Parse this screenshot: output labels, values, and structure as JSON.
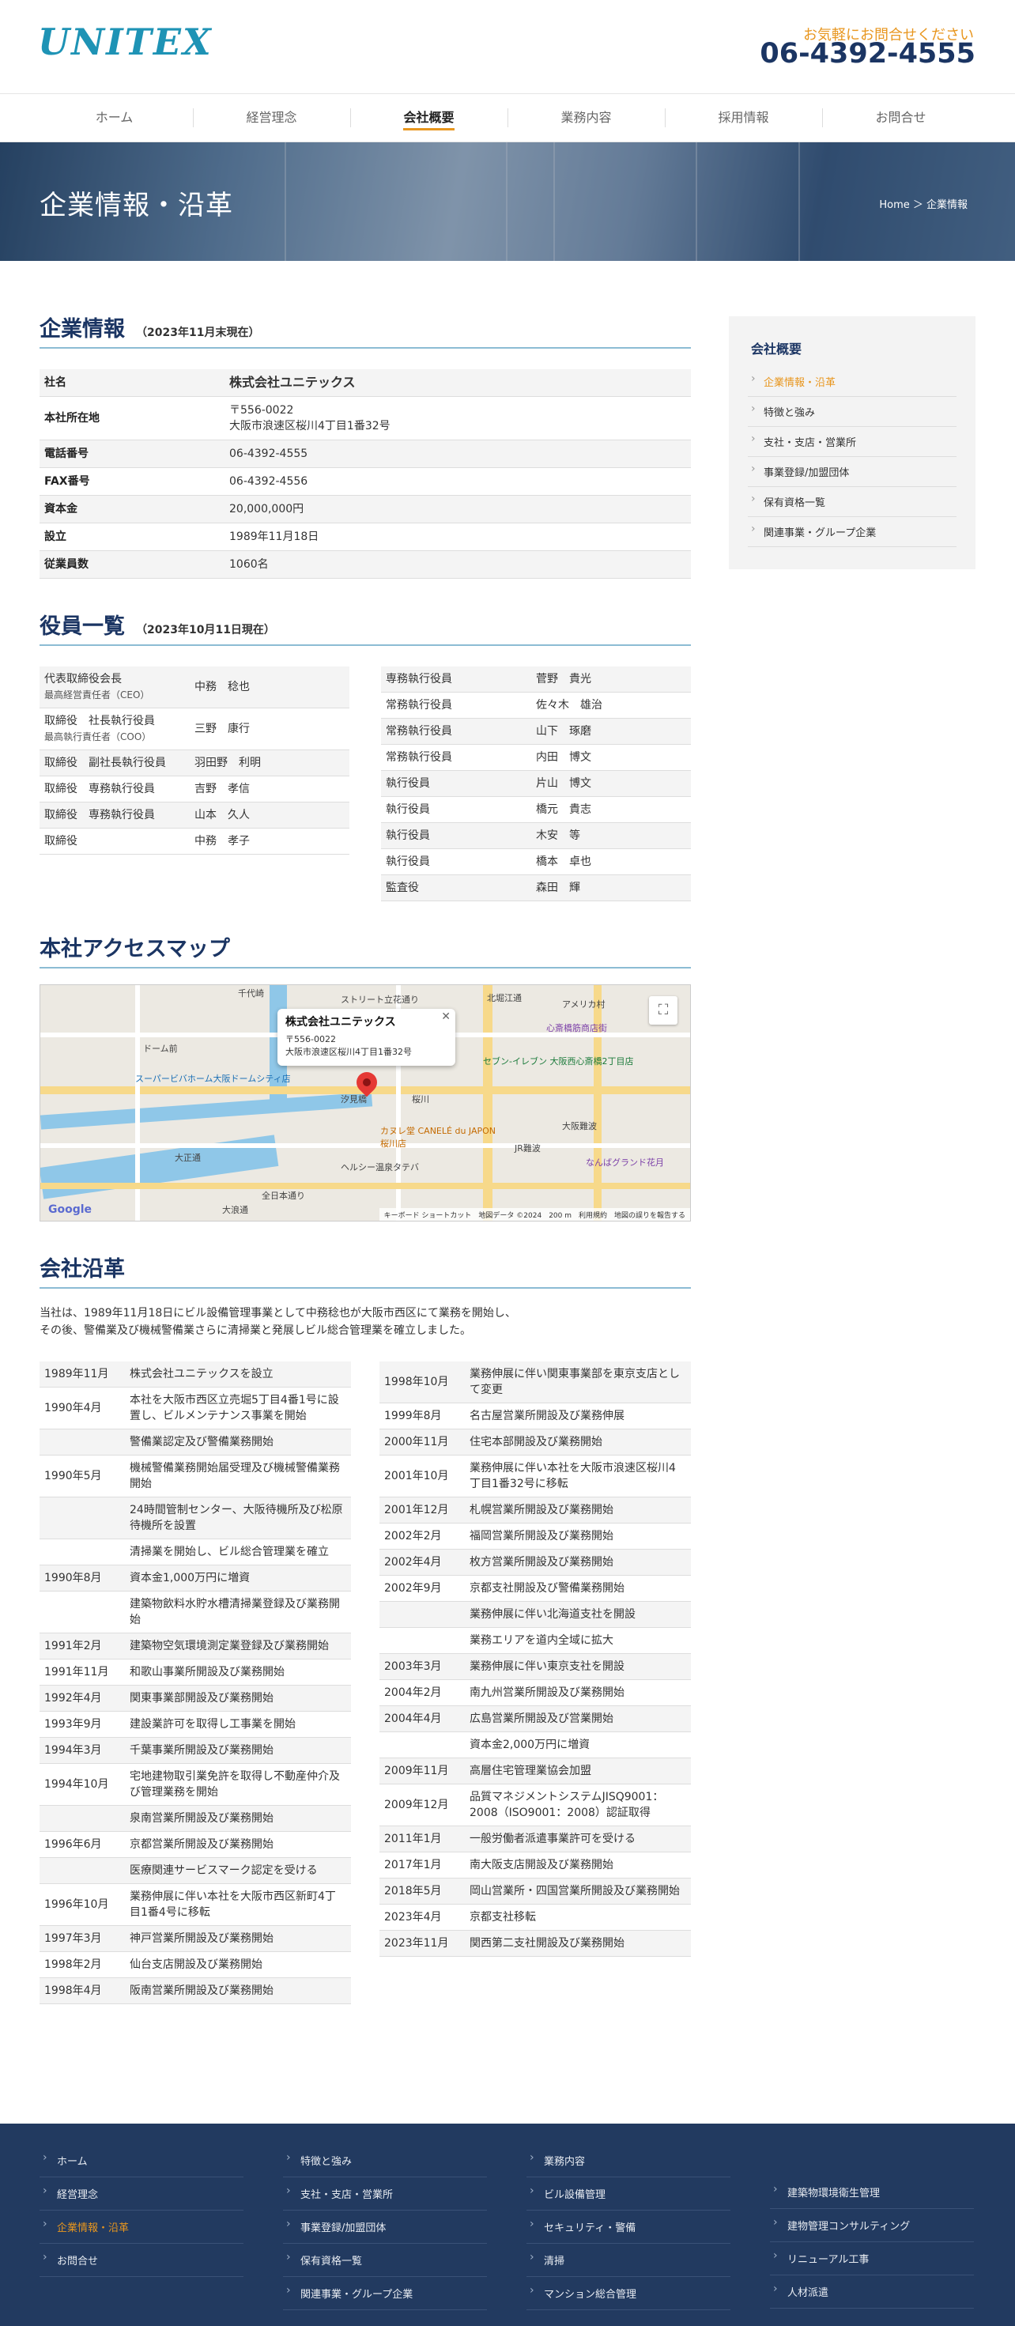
{
  "header": {
    "logo": "UNITEX",
    "contact_text": "お気軽にお問合せください",
    "phone": "06-4392-4555"
  },
  "nav": [
    {
      "label": "ホーム"
    },
    {
      "label": "経営理念"
    },
    {
      "label": "会社概要",
      "active": true
    },
    {
      "label": "業務内容"
    },
    {
      "label": "採用情報"
    },
    {
      "label": "お問合せ"
    }
  ],
  "hero": {
    "title": "企業情報・沿革",
    "breadcrumb": "Home ＞ 企業情報"
  },
  "company_info": {
    "heading": "企業情報",
    "note": "（2023年11月末現在）",
    "rows": [
      {
        "key": "社名",
        "value": "株式会社ユニテックス"
      },
      {
        "key": "本社所在地",
        "value": "〒556-0022",
        "value2": "大阪市浪速区桜川4丁目1番32号"
      },
      {
        "key": "電話番号",
        "value": "06-4392-4555"
      },
      {
        "key": "FAX番号",
        "value": "06-4392-4556"
      },
      {
        "key": "資本金",
        "value": "20,000,000円"
      },
      {
        "key": "設立",
        "value": "1989年11月18日"
      },
      {
        "key": "従業員数",
        "value": "1060名"
      }
    ]
  },
  "officers": {
    "heading": "役員一覧",
    "note": "（2023年10月11日現在）",
    "left": [
      {
        "role": "代表取締役会長",
        "sub": "最高経営責任者（CEO）",
        "name": "中務　稔也"
      },
      {
        "role": "取締役　社長執行役員",
        "sub": "最高執行責任者（COO）",
        "name": "三野　康行"
      },
      {
        "role": "取締役　副社長執行役員",
        "sub": "",
        "name": "羽田野　利明"
      },
      {
        "role": "取締役　専務執行役員",
        "sub": "",
        "name": "吉野　孝信"
      },
      {
        "role": "取締役　専務執行役員",
        "sub": "",
        "name": "山本　久人"
      },
      {
        "role": "取締役",
        "sub": "",
        "name": "中務　孝子"
      }
    ],
    "right": [
      {
        "role": "専務執行役員",
        "name": "菅野　貴光"
      },
      {
        "role": "常務執行役員",
        "name": "佐々木　雄治"
      },
      {
        "role": "常務執行役員",
        "name": "山下　琢磨"
      },
      {
        "role": "常務執行役員",
        "name": "内田　博文"
      },
      {
        "role": "執行役員",
        "name": "片山　博文"
      },
      {
        "role": "執行役員",
        "name": "橋元　貴志"
      },
      {
        "role": "執行役員",
        "name": "木安　等"
      },
      {
        "role": "執行役員",
        "name": "橋本　卓也"
      },
      {
        "role": "監査役",
        "name": "森田　輝"
      }
    ]
  },
  "access": {
    "heading": "本社アクセスマップ",
    "map_company": "株式会社ユニテックス",
    "map_zip": "〒556-0022",
    "map_address": "大阪市浪速区桜川4丁目1番32号",
    "map_footer": "キーボード ショートカット　地図データ ©2024　200 m　利用規約　地図の誤りを報告する",
    "labels": [
      "千代崎",
      "ドーム前",
      "スーパービバホーム大阪ドームシティ店",
      "ストリート立花通り",
      "北堀江通",
      "アメリカ村",
      "心斎橋筋商店街",
      "セブン-イレブン 大阪西心斎橋2丁目店",
      "大阪難波",
      "汐見橋",
      "桜川",
      "カヌレ堂 CANELÉ du JAPON 桜川店",
      "ヘルシー温泉タテバ",
      "JR難波",
      "なんばグランド花月",
      "大正通",
      "全日本通り",
      "大浪通"
    ]
  },
  "history": {
    "heading": "会社沿革",
    "intro1": "当社は、1989年11月18日にビル設備管理事業として中務稔也が大阪市西区にて業務を開始し、",
    "intro2": "その後、警備業及び機械警備業さらに清掃業と発展しビル総合管理業を確立しました。",
    "left": [
      {
        "date": "1989年11月",
        "text": "株式会社ユニテックスを設立"
      },
      {
        "date": "1990年4月",
        "text": "本社を大阪市西区立売堀5丁目4番1号に設置し、ビルメンテナンス事業を開始"
      },
      {
        "date": "",
        "text": "警備業認定及び警備業務開始"
      },
      {
        "date": "1990年5月",
        "text": "機械警備業務開始届受理及び機械警備業務開始"
      },
      {
        "date": "",
        "text": "24時間管制センター、大阪待機所及び松原待機所を設置"
      },
      {
        "date": "",
        "text": "清掃業を開始し、ビル総合管理業を確立"
      },
      {
        "date": "1990年8月",
        "text": "資本金1,000万円に増資"
      },
      {
        "date": "",
        "text": "建築物飲料水貯水槽清掃業登録及び業務開始"
      },
      {
        "date": "1991年2月",
        "text": "建築物空気環境測定業登録及び業務開始"
      },
      {
        "date": "1991年11月",
        "text": "和歌山事業所開設及び業務開始"
      },
      {
        "date": "1992年4月",
        "text": "関東事業部開設及び業務開始"
      },
      {
        "date": "1993年9月",
        "text": "建設業許可を取得し工事業を開始"
      },
      {
        "date": "1994年3月",
        "text": "千葉事業所開設及び業務開始"
      },
      {
        "date": "1994年10月",
        "text": "宅地建物取引業免許を取得し不動産仲介及び管理業務を開始"
      },
      {
        "date": "",
        "text": "泉南営業所開設及び業務開始"
      },
      {
        "date": "1996年6月",
        "text": "京都営業所開設及び業務開始"
      },
      {
        "date": "",
        "text": "医療関連サービスマーク認定を受ける"
      },
      {
        "date": "1996年10月",
        "text": "業務伸展に伴い本社を大阪市西区新町4丁目1番4号に移転"
      },
      {
        "date": "1997年3月",
        "text": "神戸営業所開設及び業務開始"
      },
      {
        "date": "1998年2月",
        "text": "仙台支店開設及び業務開始"
      },
      {
        "date": "1998年4月",
        "text": "阪南営業所開設及び業務開始"
      }
    ],
    "right": [
      {
        "date": "1998年10月",
        "text": "業務伸展に伴い関東事業部を東京支店として変更"
      },
      {
        "date": "1999年8月",
        "text": "名古屋営業所開設及び業務伸展"
      },
      {
        "date": "2000年11月",
        "text": "住宅本部開設及び業務開始"
      },
      {
        "date": "2001年10月",
        "text": "業務伸展に伴い本社を大阪市浪速区桜川4丁目1番32号に移転"
      },
      {
        "date": "2001年12月",
        "text": "札幌営業所開設及び業務開始"
      },
      {
        "date": "2002年2月",
        "text": "福岡営業所開設及び業務開始"
      },
      {
        "date": "2002年4月",
        "text": "枚方営業所開設及び業務開始"
      },
      {
        "date": "2002年9月",
        "text": "京都支社開設及び警備業務開始"
      },
      {
        "date": "",
        "text": "業務伸展に伴い北海道支社を開設"
      },
      {
        "date": "",
        "text": "業務エリアを道内全域に拡大"
      },
      {
        "date": "2003年3月",
        "text": "業務伸展に伴い東京支社を開設"
      },
      {
        "date": "2004年2月",
        "text": "南九州営業所開設及び業務開始"
      },
      {
        "date": "2004年4月",
        "text": "広島営業所開設及び営業開始"
      },
      {
        "date": "",
        "text": "資本金2,000万円に増資"
      },
      {
        "date": "2009年11月",
        "text": "高層住宅管理業協会加盟"
      },
      {
        "date": "2009年12月",
        "text": "品質マネジメントシステムJISQ9001：2008（ISO9001：2008）認証取得"
      },
      {
        "date": "2011年1月",
        "text": "一般労働者派遣事業許可を受ける"
      },
      {
        "date": "2017年1月",
        "text": "南大阪支店開設及び業務開始"
      },
      {
        "date": "2018年5月",
        "text": "岡山営業所・四国営業所開設及び業務開始"
      },
      {
        "date": "2023年4月",
        "text": "京都支社移転"
      },
      {
        "date": "2023年11月",
        "text": "関西第二支社開設及び業務開始"
      }
    ]
  },
  "sidebar": {
    "title": "会社概要",
    "items": [
      {
        "label": "企業情報・沿革",
        "active": true
      },
      {
        "label": "特徴と強み"
      },
      {
        "label": "支社・支店・営業所"
      },
      {
        "label": "事業登録/加盟団体"
      },
      {
        "label": "保有資格一覧"
      },
      {
        "label": "関連事業・グループ企業"
      }
    ]
  },
  "footer": {
    "col1": [
      {
        "label": "ホーム"
      },
      {
        "label": "経営理念"
      },
      {
        "label": "企業情報・沿革",
        "active": true
      },
      {
        "label": "お問合せ"
      }
    ],
    "col2": [
      {
        "label": "特徴と強み"
      },
      {
        "label": "支社・支店・営業所"
      },
      {
        "label": "事業登録/加盟団体"
      },
      {
        "label": "保有資格一覧"
      },
      {
        "label": "関連事業・グループ企業"
      }
    ],
    "col3": [
      {
        "label": "業務内容"
      },
      {
        "label": "ビル設備管理"
      },
      {
        "label": "セキュリティ・警備"
      },
      {
        "label": "清掃"
      },
      {
        "label": "マンション総合管理"
      }
    ],
    "col4": [
      {
        "label": "建築物環境衛生管理"
      },
      {
        "label": "建物管理コンサルティング"
      },
      {
        "label": "リニューアル工事"
      },
      {
        "label": "人材派遣"
      }
    ]
  }
}
